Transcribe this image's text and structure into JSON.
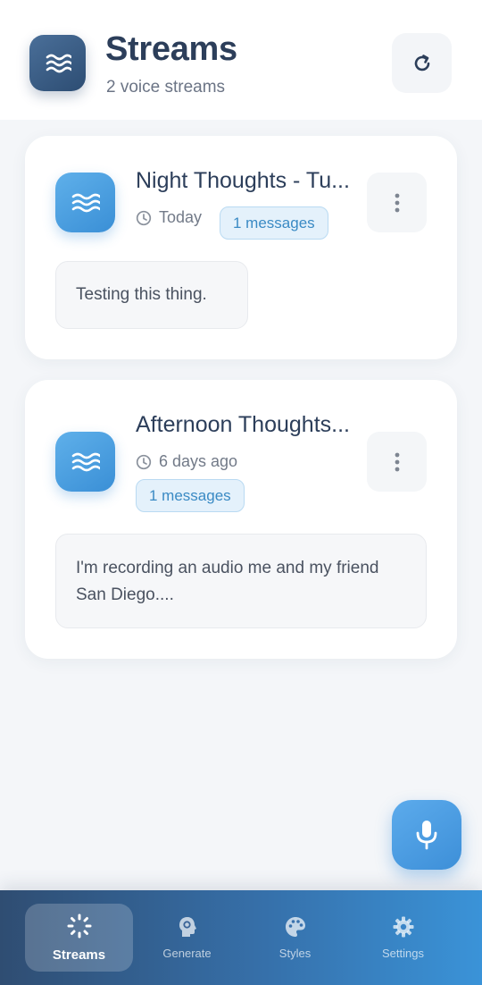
{
  "header": {
    "title": "Streams",
    "subtitle": "2 voice streams",
    "logo_icon": "waves-icon",
    "refresh_icon": "refresh-icon"
  },
  "streams": [
    {
      "title": "Night Thoughts - Tu...",
      "time": "Today",
      "badge": "1 messages",
      "preview": "Testing this thing.",
      "icon": "waves-icon"
    },
    {
      "title": "Afternoon Thoughts...",
      "time": "6 days ago",
      "badge": "1 messages",
      "preview": "I'm recording an audio me and my friend San Diego....",
      "icon": "waves-icon"
    }
  ],
  "fab": {
    "icon": "microphone-icon"
  },
  "nav": {
    "items": [
      {
        "label": "Streams",
        "icon": "sparkle-icon",
        "active": true
      },
      {
        "label": "Generate",
        "icon": "head-brain-icon",
        "active": false
      },
      {
        "label": "Styles",
        "icon": "palette-icon",
        "active": false
      },
      {
        "label": "Settings",
        "icon": "gear-icon",
        "active": false
      }
    ]
  },
  "colors": {
    "accent": "#3a8fd6",
    "title": "#2c3e5a",
    "badge_bg": "#e4f1fb",
    "nav_start": "#2f4d72",
    "nav_end": "#3a93d8"
  }
}
